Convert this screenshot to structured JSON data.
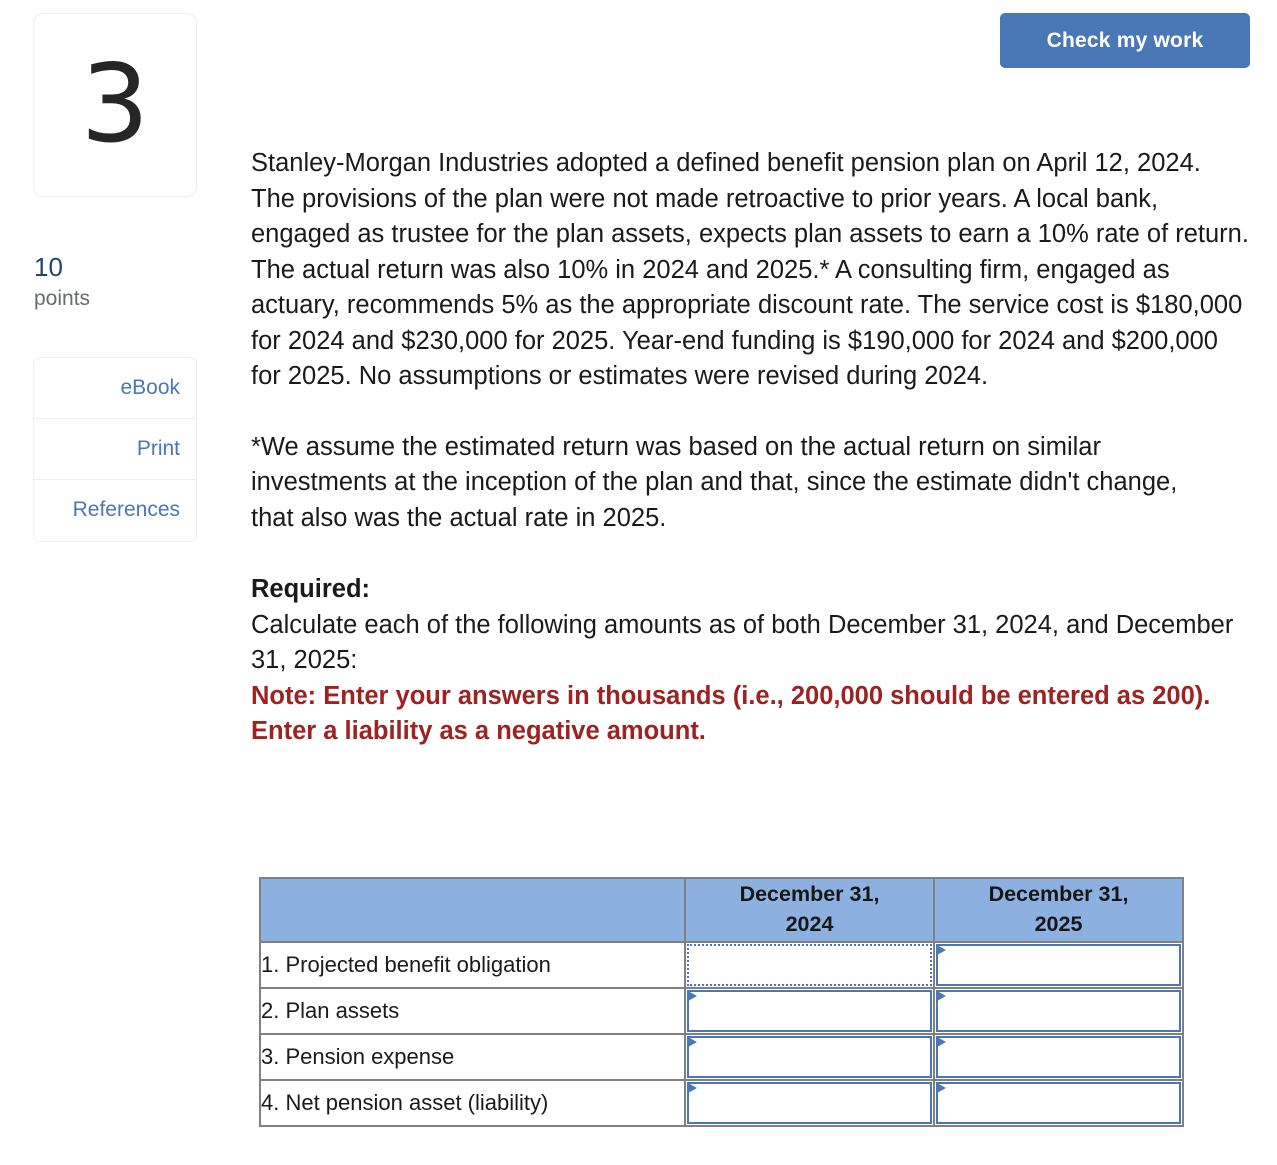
{
  "header": {
    "check_button_label": "Check my work"
  },
  "sidebar": {
    "question_number": "3",
    "points_value": "10",
    "points_label": "points",
    "tools": [
      {
        "label": "eBook"
      },
      {
        "label": "Print"
      },
      {
        "label": "References"
      }
    ]
  },
  "main": {
    "problem_paragraph": "Stanley-Morgan Industries adopted a defined benefit pension plan on April 12, 2024. The provisions of the plan were not made retroactive to prior years. A local bank, engaged as trustee for the plan assets, expects plan assets to earn a 10% rate of return. The actual return was also 10% in 2024 and 2025.* A consulting firm, engaged as actuary, recommends 5% as the appropriate discount rate. The service cost is $180,000 for 2024 and $230,000 for 2025. Year-end funding is $190,000 for 2024 and $200,000 for 2025. No assumptions or estimates were revised during 2024.",
    "footnote_paragraph": "*We assume the estimated return was based on the actual return on similar investments at the inception of the plan and that, since the estimate didn't change, that also was the actual rate in 2025.",
    "required_heading": "Required:",
    "required_text": "Calculate each of the following amounts as of both December 31, 2024, and December 31, 2025:",
    "note_text": "Note: Enter your answers in thousands (i.e., 200,000 should be entered as 200). Enter a liability as a negative amount."
  },
  "table": {
    "columns": [
      {
        "label": ""
      },
      {
        "label": "December 31, 2024"
      },
      {
        "label": "December 31, 2025"
      }
    ],
    "column_lines": [
      [
        "",
        ""
      ],
      [
        "December 31,",
        "2024"
      ],
      [
        "December 31,",
        "2025"
      ]
    ],
    "rows": [
      {
        "label": "1. Projected benefit obligation",
        "values": [
          "",
          ""
        ],
        "placeholders": [
          "",
          ""
        ],
        "focused_col": 0
      },
      {
        "label": "2. Plan assets",
        "values": [
          "",
          ""
        ],
        "placeholders": [
          "",
          ""
        ],
        "focused_col": -1
      },
      {
        "label": "3. Pension expense",
        "values": [
          "",
          ""
        ],
        "placeholders": [
          "",
          ""
        ],
        "focused_col": -1
      },
      {
        "label": "4. Net pension asset (liability)",
        "values": [
          "",
          ""
        ],
        "placeholders": [
          "",
          ""
        ],
        "focused_col": -1
      }
    ]
  },
  "colors": {
    "accent_blue": "#4a77b5",
    "header_blue": "#8cb1e0",
    "note_red": "#9d2222",
    "points_navy": "#24456e",
    "border_gray": "#808080"
  }
}
